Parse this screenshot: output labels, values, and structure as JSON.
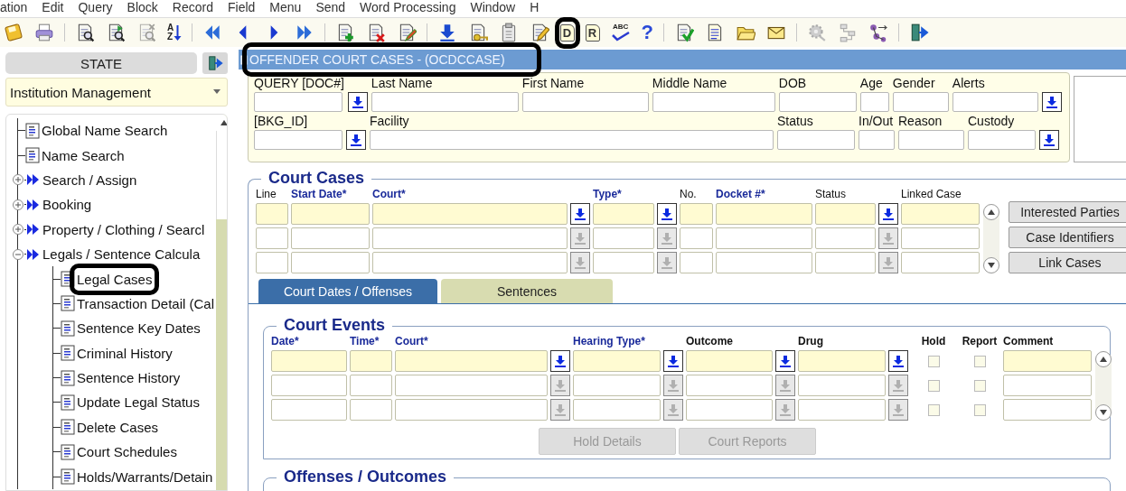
{
  "menu_bar": [
    "ation",
    "Edit",
    "Query",
    "Block",
    "Record",
    "Field",
    "Menu",
    "Send",
    "Word Processing",
    "Window",
    "H"
  ],
  "toolbar": {
    "groups": [
      [
        {
          "kind": "save",
          "highlighted": false
        },
        {
          "kind": "print",
          "highlighted": false
        }
      ],
      [
        {
          "kind": "query",
          "highlighted": false
        },
        {
          "kind": "query-run",
          "highlighted": false
        },
        {
          "kind": "query-cancel",
          "highlighted": false
        },
        {
          "kind": "sort",
          "label": "AZ",
          "highlighted": false
        }
      ],
      [
        {
          "kind": "first",
          "highlighted": false
        },
        {
          "kind": "prev",
          "highlighted": false
        },
        {
          "kind": "next",
          "highlighted": false
        },
        {
          "kind": "last",
          "highlighted": false
        }
      ],
      [
        {
          "kind": "add-record",
          "highlighted": false
        },
        {
          "kind": "delete-record",
          "highlighted": false
        },
        {
          "kind": "edit-record",
          "highlighted": false
        }
      ],
      [
        {
          "kind": "download",
          "highlighted": false
        },
        {
          "kind": "key-doc",
          "highlighted": false
        },
        {
          "kind": "clipboard",
          "highlighted": false
        },
        {
          "kind": "pencil",
          "highlighted": false
        },
        {
          "kind": "letter-doc",
          "label": "D",
          "highlighted": true
        },
        {
          "kind": "letter-doc",
          "label": "R",
          "highlighted": false
        },
        {
          "kind": "spell",
          "label": "ABC"
        },
        {
          "kind": "help",
          "label": "?"
        }
      ],
      [
        {
          "kind": "check-doc",
          "highlighted": false
        },
        {
          "kind": "doc",
          "highlighted": false
        },
        {
          "kind": "folder",
          "highlighted": false
        },
        {
          "kind": "mail",
          "highlighted": false
        }
      ],
      [
        {
          "kind": "gear",
          "highlighted": false
        },
        {
          "kind": "flow",
          "highlighted": false
        },
        {
          "kind": "network",
          "highlighted": false
        }
      ],
      [
        {
          "kind": "exit",
          "highlighted": false
        }
      ]
    ]
  },
  "sidebar": {
    "state_button": "STATE",
    "module_dropdown": {
      "value": "Institution Management"
    },
    "tree": [
      {
        "label": "Global Name Search",
        "kind": "form",
        "highlighted": false
      },
      {
        "label": "Name Search",
        "kind": "form",
        "highlighted": false
      },
      {
        "label": "Search / Assign",
        "kind": "menu",
        "expanded": false,
        "highlighted": false
      },
      {
        "label": "Booking",
        "kind": "menu",
        "expanded": false,
        "highlighted": false
      },
      {
        "label": "Property / Clothing / Searcl",
        "kind": "menu",
        "expanded": false,
        "highlighted": false
      },
      {
        "label": "Legals / Sentence Calcula",
        "kind": "menu",
        "expanded": true,
        "highlighted": false,
        "children": [
          {
            "label": "Legal Cases",
            "kind": "form",
            "highlighted": true
          },
          {
            "label": "Transaction Detail (Cal",
            "kind": "form",
            "highlighted": false
          },
          {
            "label": "Sentence Key Dates",
            "kind": "form",
            "highlighted": false
          },
          {
            "label": "Criminal History",
            "kind": "form",
            "highlighted": false
          },
          {
            "label": "Sentence History",
            "kind": "form",
            "highlighted": false
          },
          {
            "label": "Update Legal Status",
            "kind": "form",
            "highlighted": false
          },
          {
            "label": "Delete Cases",
            "kind": "form",
            "highlighted": false
          },
          {
            "label": "Court Schedules",
            "kind": "form",
            "highlighted": false
          },
          {
            "label": "Holds/Warrants/Detain",
            "kind": "form",
            "highlighted": false
          }
        ]
      }
    ]
  },
  "window": {
    "title": "OFFENDER COURT CASES - (OCDCCASE)",
    "highlighted": true
  },
  "offender_header": {
    "identity_fields": [
      {
        "label": "QUERY [DOC#]",
        "lookup": true
      },
      {
        "label": "Last Name",
        "lookup": false
      },
      {
        "label": "First Name",
        "lookup": false
      },
      {
        "label": "Middle Name",
        "lookup": false
      },
      {
        "label": "DOB",
        "lookup": false
      },
      {
        "label": "Age",
        "lookup": false
      },
      {
        "label": "Gender",
        "lookup": false
      },
      {
        "label": "Alerts",
        "lookup": true
      }
    ],
    "booking_fields": [
      {
        "label": "[BKG_ID]",
        "lookup": true
      },
      {
        "label": "Facility",
        "lookup": false
      },
      {
        "label": "Status",
        "lookup": false
      },
      {
        "label": "In/Out",
        "lookup": false
      },
      {
        "label": "Reason",
        "lookup": false
      },
      {
        "label": "Custody",
        "lookup": true
      }
    ]
  },
  "court_cases": {
    "title": "Court Cases",
    "columns": [
      {
        "label": "Line",
        "required": false,
        "lookup": false
      },
      {
        "label": "Start Date*",
        "required": true,
        "lookup": false
      },
      {
        "label": "Court*",
        "required": true,
        "lookup": true
      },
      {
        "label": "Type*",
        "required": true,
        "lookup": true
      },
      {
        "label": "No.",
        "required": false,
        "lookup": false
      },
      {
        "label": "Docket #*",
        "required": true,
        "lookup": false
      },
      {
        "label": "Status",
        "required": false,
        "lookup": true
      },
      {
        "label": "Linked Case",
        "required": false,
        "lookup": false
      }
    ],
    "rows": [
      {
        "current": true
      },
      {
        "current": false
      },
      {
        "current": false
      }
    ],
    "buttons": [
      {
        "label": "Interested Parties",
        "disabled": false
      },
      {
        "label": "Case Identifiers",
        "disabled": false
      },
      {
        "label": "Link Cases",
        "disabled": false
      }
    ]
  },
  "tabs": [
    {
      "label": "Court Dates / Offenses",
      "selected": true
    },
    {
      "label": "Sentences",
      "selected": false
    }
  ],
  "court_events": {
    "title": "Court Events",
    "columns": [
      {
        "label": "Date*",
        "required": true,
        "lookup": false,
        "kind": "field"
      },
      {
        "label": "Time*",
        "required": true,
        "lookup": false,
        "kind": "field"
      },
      {
        "label": "Court*",
        "required": true,
        "lookup": true,
        "kind": "field"
      },
      {
        "label": "Hearing Type*",
        "required": true,
        "lookup": true,
        "kind": "field"
      },
      {
        "label": "Outcome",
        "required": false,
        "lookup": true,
        "kind": "field"
      },
      {
        "label": "Drug",
        "required": false,
        "lookup": true,
        "kind": "field"
      },
      {
        "label": "Hold",
        "required": false,
        "lookup": false,
        "kind": "checkbox"
      },
      {
        "label": "Report",
        "required": false,
        "lookup": false,
        "kind": "checkbox"
      },
      {
        "label": "Comment",
        "required": false,
        "lookup": false,
        "kind": "field"
      }
    ],
    "rows": [
      {
        "current": true,
        "checked": [
          false,
          false
        ]
      },
      {
        "current": false,
        "checked": [
          false,
          false
        ]
      },
      {
        "current": false,
        "checked": [
          false,
          false
        ]
      }
    ],
    "buttons": [
      {
        "label": "Hold Details",
        "disabled": true
      },
      {
        "label": "Court Reports",
        "disabled": true
      }
    ]
  },
  "offenses_outcomes": {
    "title": "Offenses / Outcomes"
  }
}
